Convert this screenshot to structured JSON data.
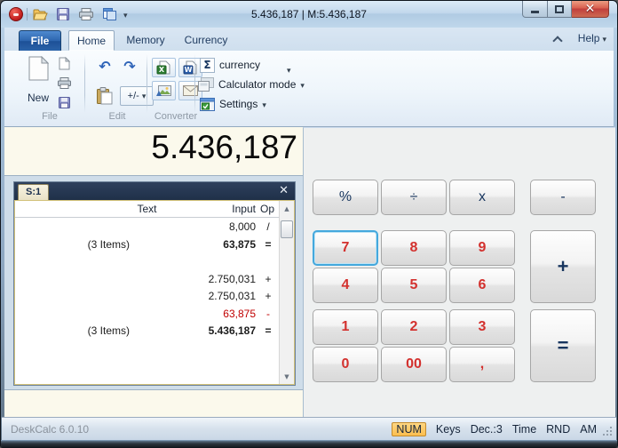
{
  "window": {
    "title": "5.436,187 | M:5.436,187"
  },
  "tabs": {
    "file": "File",
    "home": "Home",
    "memory": "Memory",
    "currency": "Currency"
  },
  "help": {
    "label": "Help"
  },
  "ribbon": {
    "file_group": {
      "new_label": "New",
      "group_label": "File"
    },
    "edit_group": {
      "plus_minus_label": "+/-",
      "group_label": "Edit"
    },
    "converter_group": {
      "group_label": "Converter"
    },
    "mode_group": {
      "sigma": "Σ",
      "currency_label": "currency",
      "calculator_mode_label": "Calculator mode",
      "settings_label": "Settings"
    }
  },
  "display": {
    "value": "5.436,187"
  },
  "tape": {
    "title_tab": "S:1",
    "columns": {
      "text": "Text",
      "input": "Input",
      "op": "Op"
    },
    "rows": [
      {
        "text": "",
        "input": "8,000",
        "op": "/"
      },
      {
        "text": "(3 Items)",
        "input": "63,875",
        "op": "="
      },
      {
        "text": "",
        "input": "",
        "op": ""
      },
      {
        "text": "",
        "input": "2.750,031",
        "op": "+"
      },
      {
        "text": "",
        "input": "2.750,031",
        "op": "+"
      },
      {
        "text": "",
        "input": "63,875",
        "op": "-"
      },
      {
        "text": "(3 Items)",
        "input": "5.436,187",
        "op": "="
      }
    ]
  },
  "keypad": {
    "percent": "%",
    "divide": "÷",
    "multiply": "x",
    "minus": "-",
    "seven": "7",
    "eight": "8",
    "nine": "9",
    "plus": "+",
    "four": "4",
    "five": "5",
    "six": "6",
    "one": "1",
    "two": "2",
    "three": "3",
    "equals": "=",
    "zero": "0",
    "double_zero": "00",
    "comma": ","
  },
  "status_bar": {
    "app_version": "DeskCalc 6.0.10",
    "num": "NUM",
    "keys": "Keys",
    "dec": "Dec.:3",
    "time": "Time",
    "rnd": "RND",
    "am": "AM"
  },
  "colors": {
    "digit_red": "#d3312e",
    "operator_navy": "#17355e",
    "tape_negative_red": "#c00000",
    "num_badge_bg": "#fbbe4e",
    "title_glass_blue": "#bdd4e9",
    "tape_titlebar_navy": "#243650"
  }
}
